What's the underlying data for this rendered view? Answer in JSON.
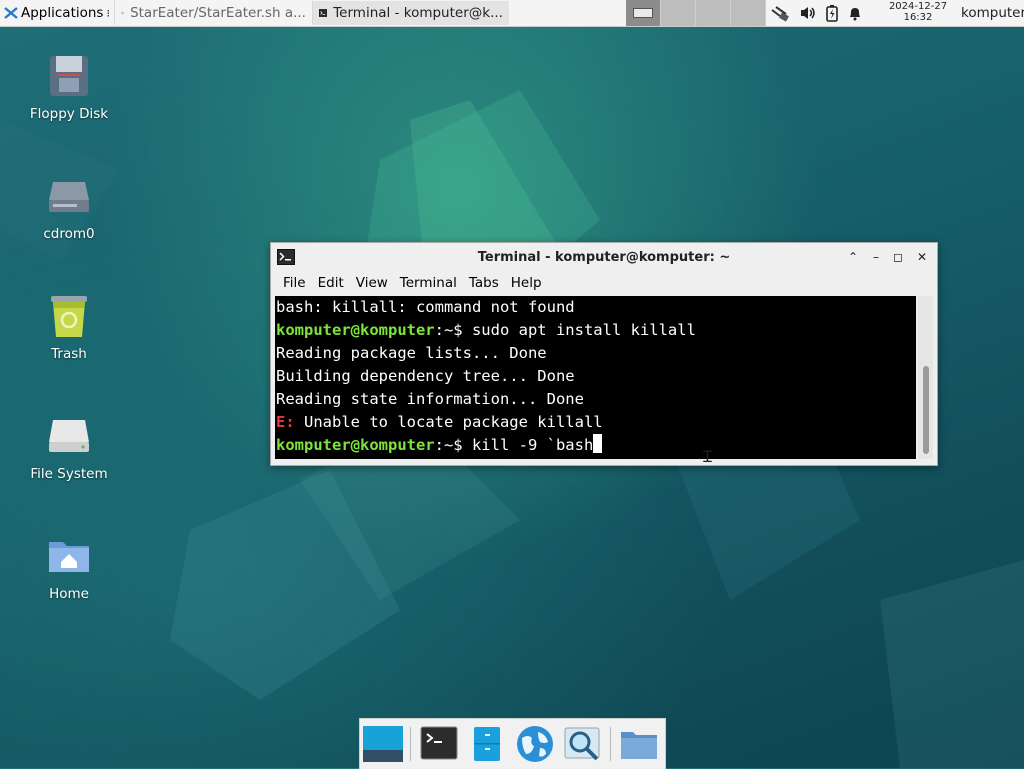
{
  "top_panel": {
    "applications_label": "Applications",
    "tasks": [
      {
        "title": "StarEater/StarEater.sh a..."
      },
      {
        "title": "Terminal - komputer@k..."
      }
    ],
    "clock": {
      "date": "2024-12-27",
      "time": "16:32"
    },
    "user": "komputer"
  },
  "desktop_icons": [
    {
      "label": "Floppy Disk"
    },
    {
      "label": "cdrom0"
    },
    {
      "label": "Trash"
    },
    {
      "label": "File System"
    },
    {
      "label": "Home"
    }
  ],
  "terminal": {
    "title": "Terminal - komputer@komputer: ~",
    "menu": [
      "File",
      "Edit",
      "View",
      "Terminal",
      "Tabs",
      "Help"
    ],
    "lines": {
      "l1": "bash: killall: command not found",
      "p1_user": "komputer@komputer",
      "p1_sep": ":~$ ",
      "p1_cmd": "sudo apt install killall",
      "l3": "Reading package lists... Done",
      "l4": "Building dependency tree... Done",
      "l5": "Reading state information... Done",
      "err_tag": "E:",
      "err_msg": " Unable to locate package killall",
      "p2_user": "komputer@komputer",
      "p2_sep": ":~$ ",
      "p2_cmd": "kill -9 `bash"
    }
  },
  "dock_items": [
    "desktop-icon",
    "terminal-icon",
    "file-manager-icon",
    "web-browser-icon",
    "app-finder-icon",
    "folder-icon"
  ],
  "colors": {
    "prompt": "#7ee33b",
    "error": "#e8383d",
    "terminal_bg": "#000000"
  }
}
